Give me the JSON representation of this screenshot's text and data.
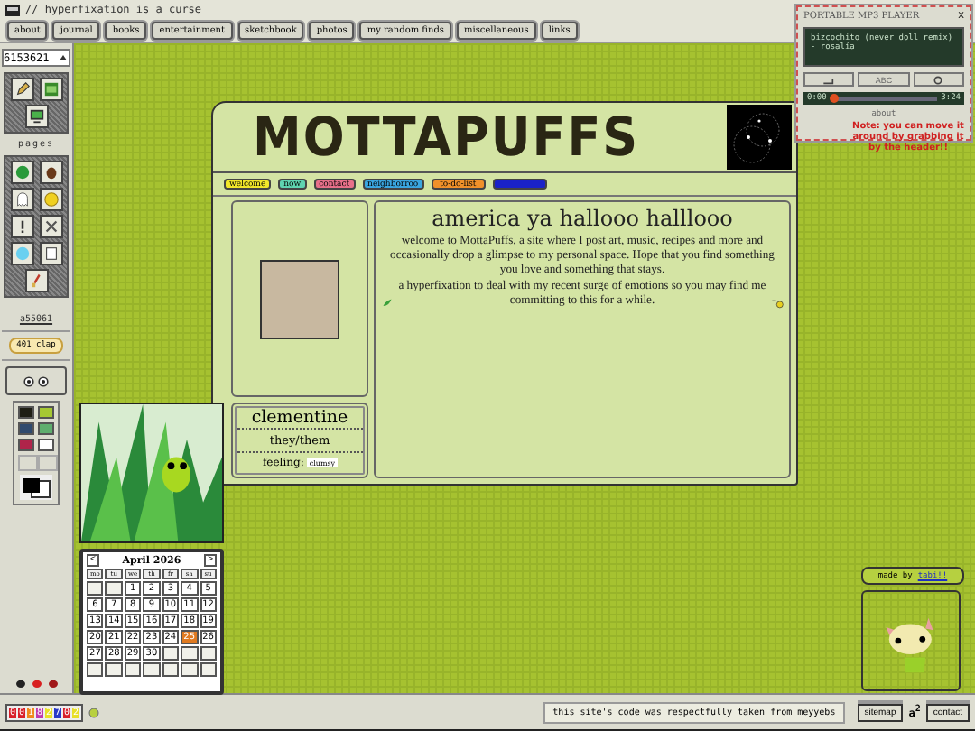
{
  "window": {
    "title": "// hyperfixation is a curse"
  },
  "nav": [
    "about",
    "journal",
    "books",
    "entertainment",
    "sketchbook",
    "photos",
    "my random finds",
    "miscellaneous",
    "links"
  ],
  "sidebar": {
    "counter_select": "6153621",
    "pages_label": "pages",
    "link": "a55061",
    "clap": "401 clap",
    "palette": [
      {
        "color": "#1e1e14"
      },
      {
        "color": "#a6c833"
      },
      {
        "color": "#2f4a6e"
      },
      {
        "color": "#5fae6e"
      },
      {
        "color": "#b0244a"
      },
      {
        "color": "#ffffff"
      }
    ]
  },
  "card": {
    "title": "MOTTAPUFFS",
    "pills": [
      {
        "label": "welcome",
        "color": "#f2e62a"
      },
      {
        "label": "now",
        "color": "#5fd3b0"
      },
      {
        "label": "contact",
        "color": "#e8708a"
      },
      {
        "label": "neighborroo",
        "color": "#3aa6e0"
      },
      {
        "label": "to-do-list",
        "color": "#f0902a"
      },
      {
        "color": "#1a22c8"
      }
    ],
    "name": "clementine",
    "pronouns": "they/them",
    "feeling_label": "feeling:",
    "feeling": "clumsy",
    "heading": "america ya hallooo halllooo",
    "intro": "welcome to MottaPuffs, a site where I post art, music, recipes and more and occasionally drop a glimpse to my personal space. Hope that you find something you love and something that stays.",
    "body": "a hyperfixation to deal with my recent surge of emotions so you may find me committing to this for a while."
  },
  "player": {
    "title": "PORTABLE MP3 PLAYER",
    "close": "X",
    "track": "bizcochito (never doll remix) - rosalía",
    "play_label": "ABC",
    "elapsed": "0:00",
    "duration": "3:24",
    "level": 0.03,
    "footer": "about"
  },
  "note": "Note: you can move it around by grabbing it by the header!!",
  "calendar": {
    "month": "April 2026",
    "prev": "<",
    "next": ">",
    "weekdays": [
      "mo",
      "tu",
      "we",
      "th",
      "fr",
      "sa",
      "su"
    ],
    "days": [
      {
        "kind": "blank"
      },
      {
        "kind": "blank"
      },
      {
        "label": "1",
        "selected": false
      },
      {
        "label": "2",
        "selected": false
      },
      {
        "label": "3",
        "selected": false
      },
      {
        "label": "4",
        "selected": false
      },
      {
        "label": "5",
        "selected": false
      },
      {
        "label": "6",
        "selected": false
      },
      {
        "label": "7",
        "selected": false
      },
      {
        "label": "8",
        "selected": false
      },
      {
        "label": "9",
        "selected": false
      },
      {
        "label": "10",
        "selected": false
      },
      {
        "label": "11",
        "selected": false
      },
      {
        "label": "12",
        "selected": false
      },
      {
        "label": "13",
        "selected": false
      },
      {
        "label": "14",
        "selected": false
      },
      {
        "label": "15",
        "selected": false
      },
      {
        "label": "16",
        "selected": false
      },
      {
        "label": "17",
        "selected": false
      },
      {
        "label": "18",
        "selected": false
      },
      {
        "label": "19",
        "selected": false
      },
      {
        "label": "20",
        "selected": false
      },
      {
        "label": "21",
        "selected": false
      },
      {
        "label": "22",
        "selected": false
      },
      {
        "label": "23",
        "selected": false
      },
      {
        "label": "24",
        "selected": false
      },
      {
        "label": "25",
        "selected": true
      },
      {
        "label": "26",
        "selected": false
      },
      {
        "label": "27",
        "selected": false
      },
      {
        "label": "28",
        "selected": false
      },
      {
        "label": "29",
        "selected": false
      },
      {
        "label": "30",
        "selected": false
      },
      {
        "kind": "blank"
      },
      {
        "kind": "blank"
      },
      {
        "kind": "blank"
      },
      {
        "kind": "blank"
      },
      {
        "kind": "blank"
      },
      {
        "kind": "blank"
      },
      {
        "kind": "blank"
      },
      {
        "kind": "blank"
      },
      {
        "kind": "blank"
      },
      {
        "kind": "blank"
      }
    ]
  },
  "made_by": {
    "label": "made by",
    "link": "tabi!!"
  },
  "status_bar": {
    "counter": [
      {
        "digit": "0",
        "color": "#d8202a"
      },
      {
        "digit": "0",
        "color": "#d8202a"
      },
      {
        "digit": "1",
        "color": "#f08a1e"
      },
      {
        "digit": "8",
        "color": "#c03ab0"
      },
      {
        "digit": "2",
        "color": "#e8e02a"
      },
      {
        "digit": "7",
        "color": "#2a3ac8"
      },
      {
        "digit": "0",
        "color": "#d8202a"
      },
      {
        "digit": "2",
        "color": "#e8e02a"
      }
    ],
    "credit": "this site's code was respectfully taken from meyyebs",
    "buttons": [
      "sitemap",
      "contact"
    ],
    "mark": "a$^{2}$"
  }
}
